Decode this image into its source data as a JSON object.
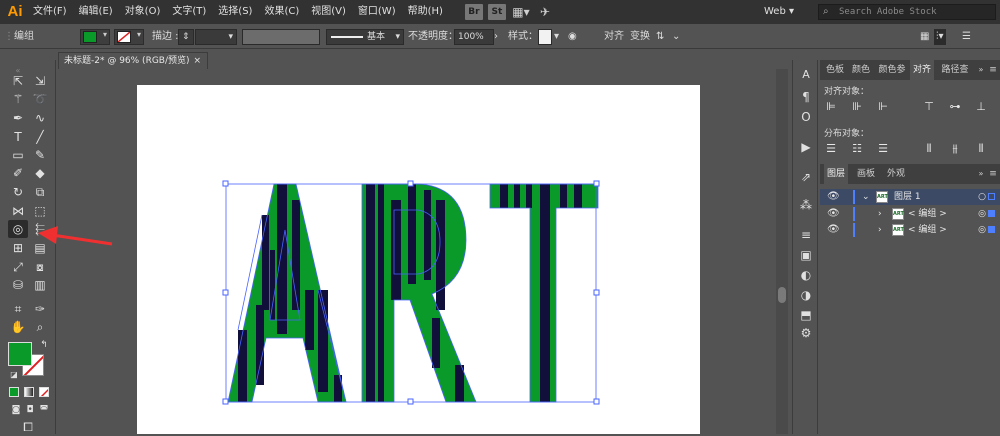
{
  "menubar": {
    "app_logo": "Ai",
    "menus": [
      "文件(F)",
      "编辑(E)",
      "对象(O)",
      "文字(T)",
      "选择(S)",
      "效果(C)",
      "视图(V)",
      "窗口(W)",
      "帮助(H)"
    ],
    "bridge_label": "Br",
    "stock_label": "St",
    "workspace": "Web",
    "search_placeholder": "Search Adobe Stock"
  },
  "control_bar": {
    "selection_label": "编组",
    "fill_color": "#0a9a2a",
    "stroke_label": "描边",
    "stroke_style": "基本",
    "opacity_label": "不透明度",
    "opacity_value": "100%",
    "style_label": "样式",
    "align_label": "对齐",
    "transform_label": "变换"
  },
  "document": {
    "tab_title": "未标题-2* @ 96% (RGB/预览)",
    "close_glyph": "×",
    "artwork_text": "ART",
    "fill_color": "#0a9a2a",
    "stripe_color": "#10103a",
    "selection_color": "#4a63ff"
  },
  "toolbox": {
    "fill_color": "#0a9a2a"
  },
  "panel_align": {
    "tabs": [
      "色板",
      "颜色",
      "颜色参",
      "对齐",
      "路径查"
    ],
    "active_tab": "对齐",
    "align_objects_label": "对齐对象：",
    "distribute_objects_label": "分布对象："
  },
  "panel_layers": {
    "tabs": [
      "图层",
      "画板",
      "外观"
    ],
    "active_tab": "图层",
    "rows": [
      {
        "name": "图层 1",
        "level": 0,
        "thumb": "ART"
      },
      {
        "name": "< 编组 >",
        "level": 1,
        "thumb": "ART"
      },
      {
        "name": "< 编组 >",
        "level": 1,
        "thumb": "ART"
      }
    ]
  },
  "annotation": {
    "arrow_color": "#f03030"
  }
}
